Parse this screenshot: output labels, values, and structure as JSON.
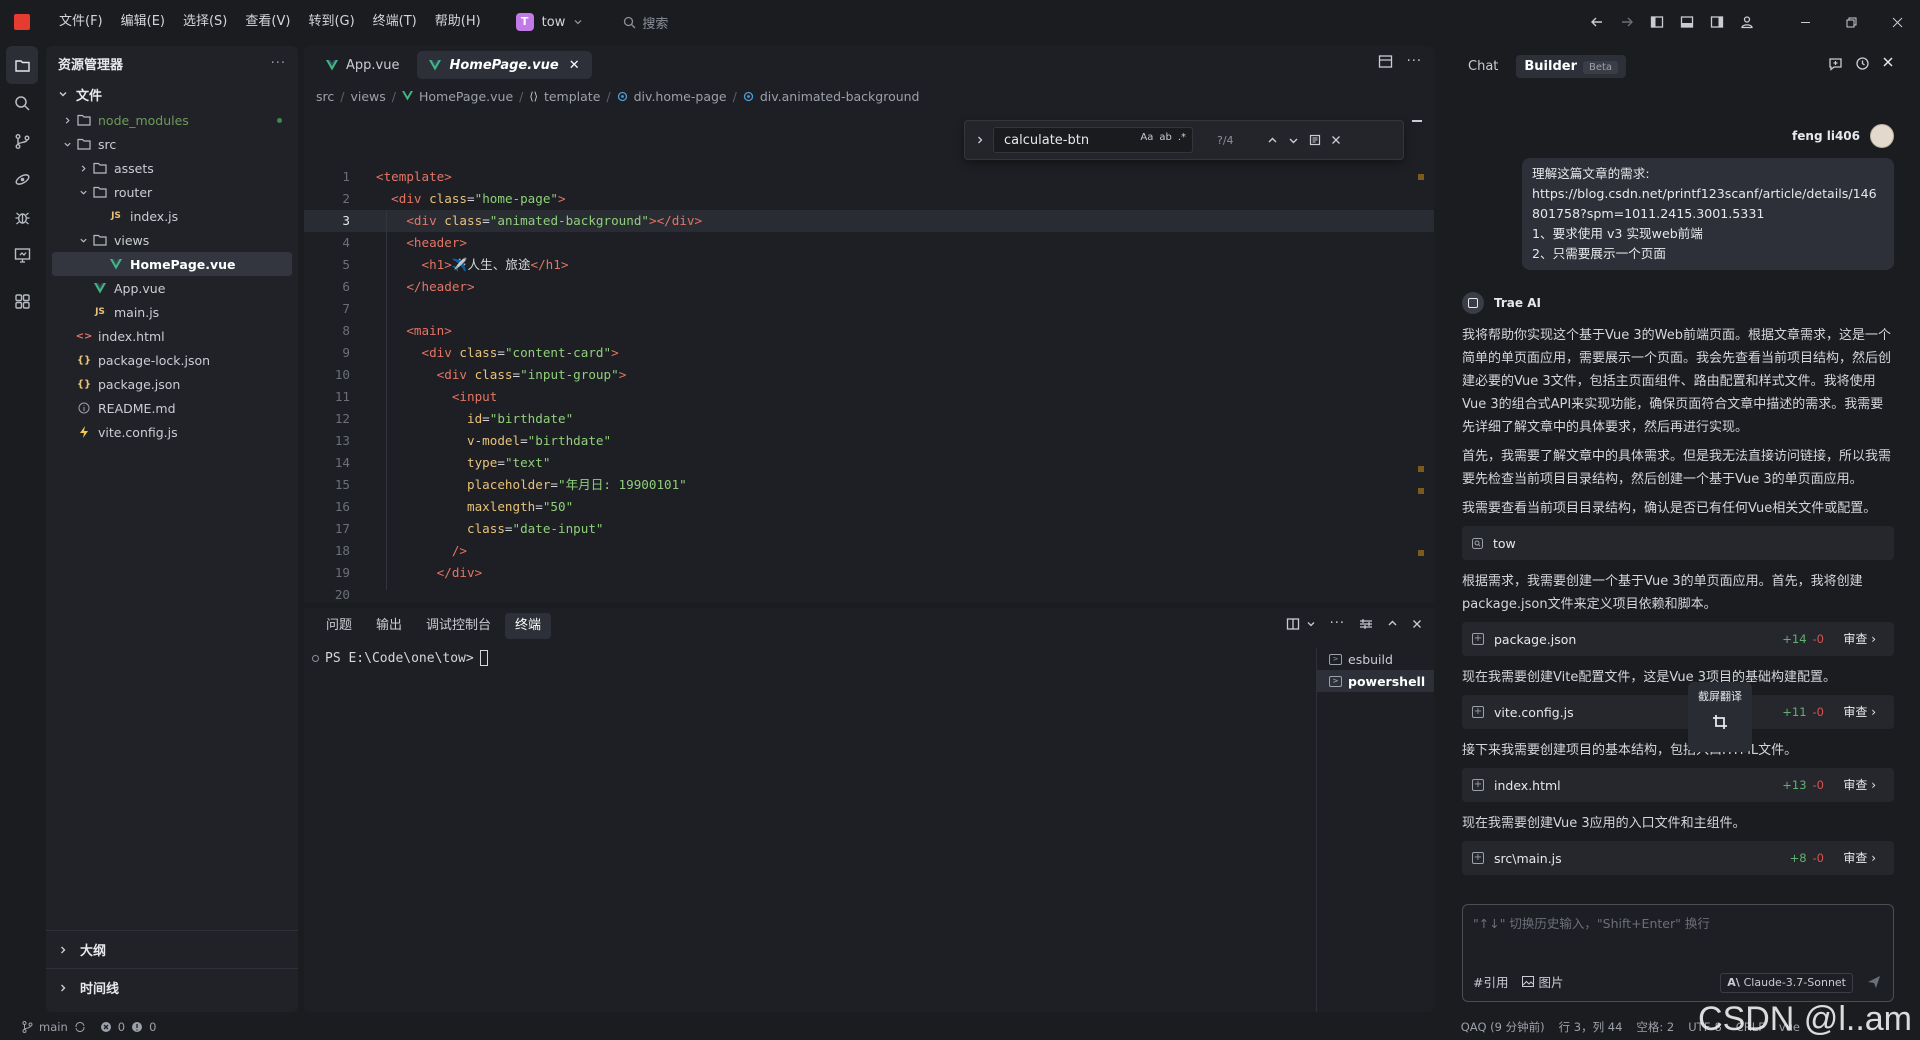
{
  "menubar": {
    "items": [
      "文件(F)",
      "编辑(E)",
      "选择(S)",
      "查看(V)",
      "转到(G)",
      "终端(T)",
      "帮助(H)"
    ],
    "project_badge": "T",
    "project_name": "tow",
    "search_label": "搜索"
  },
  "sidebar": {
    "title": "资源管理器",
    "section": "文件",
    "tree": [
      {
        "label": "node_modules",
        "type": "folder",
        "depth": 0,
        "collapsed": true
      },
      {
        "label": "src",
        "type": "folder",
        "depth": 0,
        "collapsed": false
      },
      {
        "label": "assets",
        "type": "folder",
        "depth": 1,
        "collapsed": true
      },
      {
        "label": "router",
        "type": "folder",
        "depth": 1,
        "collapsed": false
      },
      {
        "label": "index.js",
        "type": "js",
        "depth": 2
      },
      {
        "label": "views",
        "type": "folder",
        "depth": 1,
        "collapsed": false
      },
      {
        "label": "HomePage.vue",
        "type": "vue",
        "depth": 2,
        "selected": true
      },
      {
        "label": "App.vue",
        "type": "vue",
        "depth": 1
      },
      {
        "label": "main.js",
        "type": "js",
        "depth": 1
      },
      {
        "label": "index.html",
        "type": "html",
        "depth": 0
      },
      {
        "label": "package-lock.json",
        "type": "json",
        "depth": 0
      },
      {
        "label": "package.json",
        "type": "json",
        "depth": 0
      },
      {
        "label": "README.md",
        "type": "md",
        "depth": 0
      },
      {
        "label": "vite.config.js",
        "type": "vite",
        "depth": 0
      }
    ],
    "outline_label": "大纲",
    "timeline_label": "时间线"
  },
  "editor": {
    "tabs": [
      {
        "label": "App.vue",
        "active": false
      },
      {
        "label": "HomePage.vue",
        "active": true
      }
    ],
    "breadcrumb": [
      "src",
      "views",
      "HomePage.vue",
      "template",
      "div.home-page",
      "div.animated-background"
    ],
    "find": {
      "value": "calculate-btn",
      "count": "?/4",
      "opt_case": "Aa",
      "opt_word": "ab",
      "opt_regex": ".*"
    },
    "current_line": 3,
    "lines": [
      [
        [
          "t-tag",
          "<template>"
        ]
      ],
      [
        [
          "t-txt",
          "  "
        ],
        [
          "t-tag",
          "<div "
        ],
        [
          "t-attr",
          "class"
        ],
        [
          "t-txt",
          "="
        ],
        [
          "t-str",
          "\"home-page\""
        ],
        [
          "t-tag",
          ">"
        ]
      ],
      [
        [
          "t-txt",
          "    "
        ],
        [
          "t-tag",
          "<div "
        ],
        [
          "t-attr",
          "class"
        ],
        [
          "t-txt",
          "="
        ],
        [
          "t-str",
          "\"animated-background\""
        ],
        [
          "t-tag",
          "></div>"
        ]
      ],
      [
        [
          "t-txt",
          "    "
        ],
        [
          "t-tag",
          "<header>"
        ]
      ],
      [
        [
          "t-txt",
          "      "
        ],
        [
          "t-tag",
          "<h1>"
        ],
        [
          "t-txt",
          "✈️人生、旅途"
        ],
        [
          "t-tag",
          "</h1>"
        ]
      ],
      [
        [
          "t-txt",
          "    "
        ],
        [
          "t-tag",
          "</header>"
        ]
      ],
      [
        [
          "t-txt",
          ""
        ]
      ],
      [
        [
          "t-txt",
          "    "
        ],
        [
          "t-tag",
          "<main>"
        ]
      ],
      [
        [
          "t-txt",
          "      "
        ],
        [
          "t-tag",
          "<div "
        ],
        [
          "t-attr",
          "class"
        ],
        [
          "t-txt",
          "="
        ],
        [
          "t-str",
          "\"content-card\""
        ],
        [
          "t-tag",
          ">"
        ]
      ],
      [
        [
          "t-txt",
          "        "
        ],
        [
          "t-tag",
          "<div "
        ],
        [
          "t-attr",
          "class"
        ],
        [
          "t-txt",
          "="
        ],
        [
          "t-str",
          "\"input-group\""
        ],
        [
          "t-tag",
          ">"
        ]
      ],
      [
        [
          "t-txt",
          "          "
        ],
        [
          "t-tag",
          "<input"
        ]
      ],
      [
        [
          "t-txt",
          "            "
        ],
        [
          "t-attr",
          "id"
        ],
        [
          "t-txt",
          "="
        ],
        [
          "t-str",
          "\"birthdate\""
        ]
      ],
      [
        [
          "t-txt",
          "            "
        ],
        [
          "t-attr",
          "v-model"
        ],
        [
          "t-txt",
          "="
        ],
        [
          "t-str",
          "\"birthdate\""
        ]
      ],
      [
        [
          "t-txt",
          "            "
        ],
        [
          "t-attr",
          "type"
        ],
        [
          "t-txt",
          "="
        ],
        [
          "t-str",
          "\"text\""
        ]
      ],
      [
        [
          "t-txt",
          "            "
        ],
        [
          "t-attr",
          "placeholder"
        ],
        [
          "t-txt",
          "="
        ],
        [
          "t-str",
          "\"年月日: 19900101\""
        ]
      ],
      [
        [
          "t-txt",
          "            "
        ],
        [
          "t-attr",
          "maxlength"
        ],
        [
          "t-txt",
          "="
        ],
        [
          "t-str",
          "\"50\""
        ]
      ],
      [
        [
          "t-txt",
          "            "
        ],
        [
          "t-attr",
          "class"
        ],
        [
          "t-txt",
          "="
        ],
        [
          "t-str",
          "\"date-input\""
        ]
      ],
      [
        [
          "t-txt",
          "          "
        ],
        [
          "t-tag",
          "/>"
        ]
      ],
      [
        [
          "t-txt",
          "        "
        ],
        [
          "t-tag",
          "</div>"
        ]
      ],
      [
        [
          "t-txt",
          ""
        ]
      ]
    ]
  },
  "panel": {
    "tabs": [
      {
        "label": "问题",
        "active": false
      },
      {
        "label": "输出",
        "active": false
      },
      {
        "label": "调试控制台",
        "active": false
      },
      {
        "label": "终端",
        "active": true
      }
    ],
    "terminal_prompt": "PS E:\\Code\\one\\tow>",
    "terminals": [
      {
        "label": "esbuild",
        "active": false
      },
      {
        "label": "powershell",
        "active": true
      }
    ]
  },
  "chat": {
    "tab_chat": "Chat",
    "tab_builder": "Builder",
    "beta": "Beta",
    "user_name": "feng li406",
    "user_message_lines": [
      "理解这篇文章的需求:",
      "https://blog.csdn.net/printf123scanf/article/details/146801758?spm=1011.2415.3001.5331",
      "1、要求使用 v3 实现web前端",
      "2、只需要展示一个页面"
    ],
    "ai_name": "Trae AI",
    "paragraphs": [
      "我将帮助你实现这个基于Vue 3的Web前端页面。根据文章需求，这是一个简单的单页面应用，需要展示一个页面。我会先查看当前项目结构，然后创建必要的Vue 3文件，包括主页面组件、路由配置和样式文件。我将使用Vue 3的组合式API来实现功能，确保页面符合文章中描述的需求。我需要先详细了解文章中的具体要求，然后再进行实现。",
      "首先，我需要了解文章中的具体需求。但是我无法直接访问链接，所以我需要先检查当前项目目录结构，然后创建一个基于Vue 3的单页面应用。",
      "我需要查看当前项目目录结构，确认是否已有任何Vue相关文件或配置。"
    ],
    "search_chip": "tow",
    "step2": "根据需求，我需要创建一个基于Vue 3的单页面应用。首先，我将创建package.json文件来定义项目依赖和脚本。",
    "step3": "现在我需要创建Vite配置文件，这是Vue 3项目的基础构建配置。",
    "step4": "接下来我需要创建项目的基本结构，包括入口HTML文件。",
    "step5": "现在我需要创建Vue 3应用的入口文件和主组件。",
    "files": [
      {
        "name": "package.json",
        "added": "+14",
        "removed": "-0",
        "action": "审查"
      },
      {
        "name": "vite.config.js",
        "added": "+11",
        "removed": "-0",
        "action": "审查"
      },
      {
        "name": "index.html",
        "added": "+13",
        "removed": "-0",
        "action": "审查"
      },
      {
        "name": "src\\main.js",
        "added": "+8",
        "removed": "-0",
        "action": "审查"
      }
    ],
    "tooltip": "截屏翻译",
    "input_placeholder": "\"↑↓\" 切换历史输入，\"Shift+Enter\" 换行",
    "cite_label": "#引用",
    "image_label": "图片",
    "model": "Claude-3.7-Sonnet"
  },
  "statusbar": {
    "branch": "main",
    "errors": "0",
    "warnings": "0",
    "qaq": "QAQ (9 分钟前)",
    "position": "行 3，列 44",
    "spaces": "空格: 2",
    "encoding": "UTF-8",
    "eol": "CRLF",
    "language": "vue"
  },
  "watermark": "CSDN @l..am"
}
